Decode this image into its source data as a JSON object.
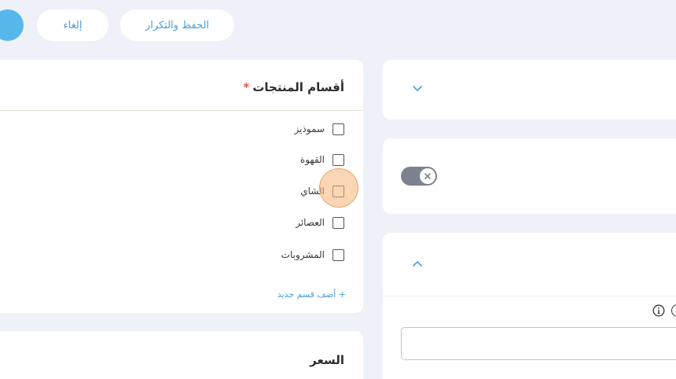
{
  "toolbar": {
    "save_repeat_label": "الحفظ والتكرار",
    "cancel_label": "إلغاء"
  },
  "categories_card": {
    "title": "أقسام المنتجات",
    "required_mark": "*",
    "items": [
      {
        "label": "سموذيز",
        "checked": false
      },
      {
        "label": "القهوة",
        "checked": false
      },
      {
        "label": "الشاي",
        "checked": false
      },
      {
        "label": "العصائر",
        "checked": false
      },
      {
        "label": "المشروبات",
        "checked": false
      }
    ],
    "add_link": "+ أضف قسم جديد"
  },
  "price_card": {
    "title": "السعر"
  },
  "icons": {
    "collapse": "chevron-down-icon",
    "expand": "chevron-up-icon",
    "toggle_off": "close-icon",
    "info": "info-icon"
  },
  "colors": {
    "accent": "#4a9fd6",
    "primary_button": "#58b7ea",
    "background": "#eef1f8",
    "required": "#e05a4a",
    "toggle_off": "#7d8290",
    "highlight": "#f6b478"
  }
}
